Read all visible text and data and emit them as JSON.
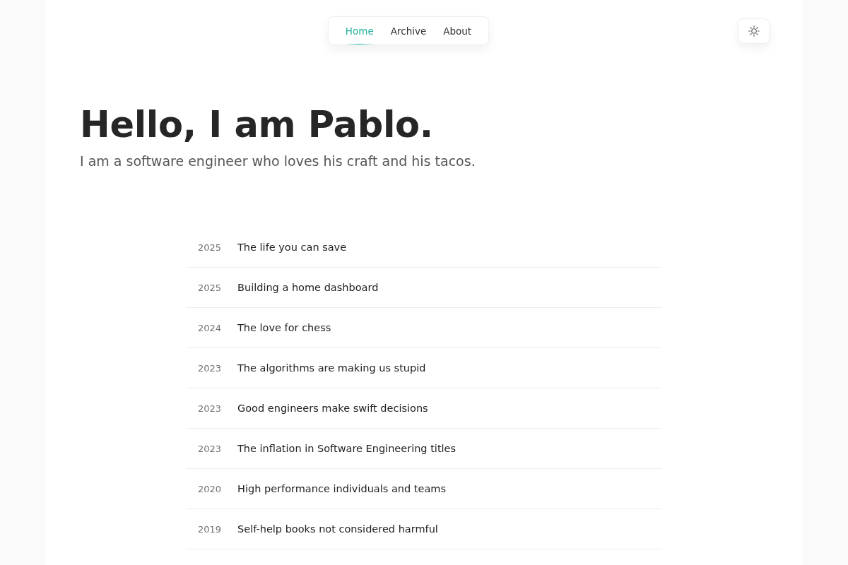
{
  "nav": {
    "links": [
      {
        "label": "Home",
        "selected": true
      },
      {
        "label": "Archive",
        "selected": false
      },
      {
        "label": "About",
        "selected": false
      }
    ]
  },
  "hero": {
    "title": "Hello, I am Pablo.",
    "subtitle": "I am a software engineer who loves his craft and his tacos."
  },
  "posts": [
    {
      "year": "2025",
      "title": "The life you can save"
    },
    {
      "year": "2025",
      "title": "Building a home dashboard"
    },
    {
      "year": "2024",
      "title": "The love for chess"
    },
    {
      "year": "2023",
      "title": "The algorithms are making us stupid"
    },
    {
      "year": "2023",
      "title": "Good engineers make swift decisions"
    },
    {
      "year": "2023",
      "title": "The inflation in Software Engineering titles"
    },
    {
      "year": "2020",
      "title": "High performance individuals and teams"
    },
    {
      "year": "2019",
      "title": "Self-help books not considered harmful"
    }
  ]
}
